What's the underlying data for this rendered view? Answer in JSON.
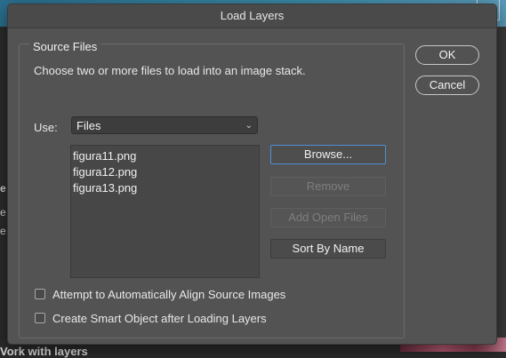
{
  "dialog": {
    "title": "Load Layers",
    "group_title": "Source Files",
    "description": "Choose two or more files to load into an image stack.",
    "use_label": "Use:",
    "use_value": "Files",
    "files": [
      "figura11.png",
      "figura12.png",
      "figura13.png"
    ],
    "buttons": {
      "browse": "Browse...",
      "remove": "Remove",
      "add_open_files": "Add Open Files",
      "sort_by_name": "Sort By Name"
    },
    "checkboxes": {
      "align": "Attempt to Automatically Align Source Images",
      "smart_object": "Create Smart Object after Loading Layers"
    },
    "ok": "OK",
    "cancel": "Cancel"
  },
  "background": {
    "close_glyph": "×",
    "fragment_1": "e",
    "fragment_2": "e",
    "fragment_3": "e",
    "footer_text": "Vork with layers"
  },
  "colors": {
    "dialog_bg": "#535353",
    "focus_ring": "#4f8fd8"
  }
}
